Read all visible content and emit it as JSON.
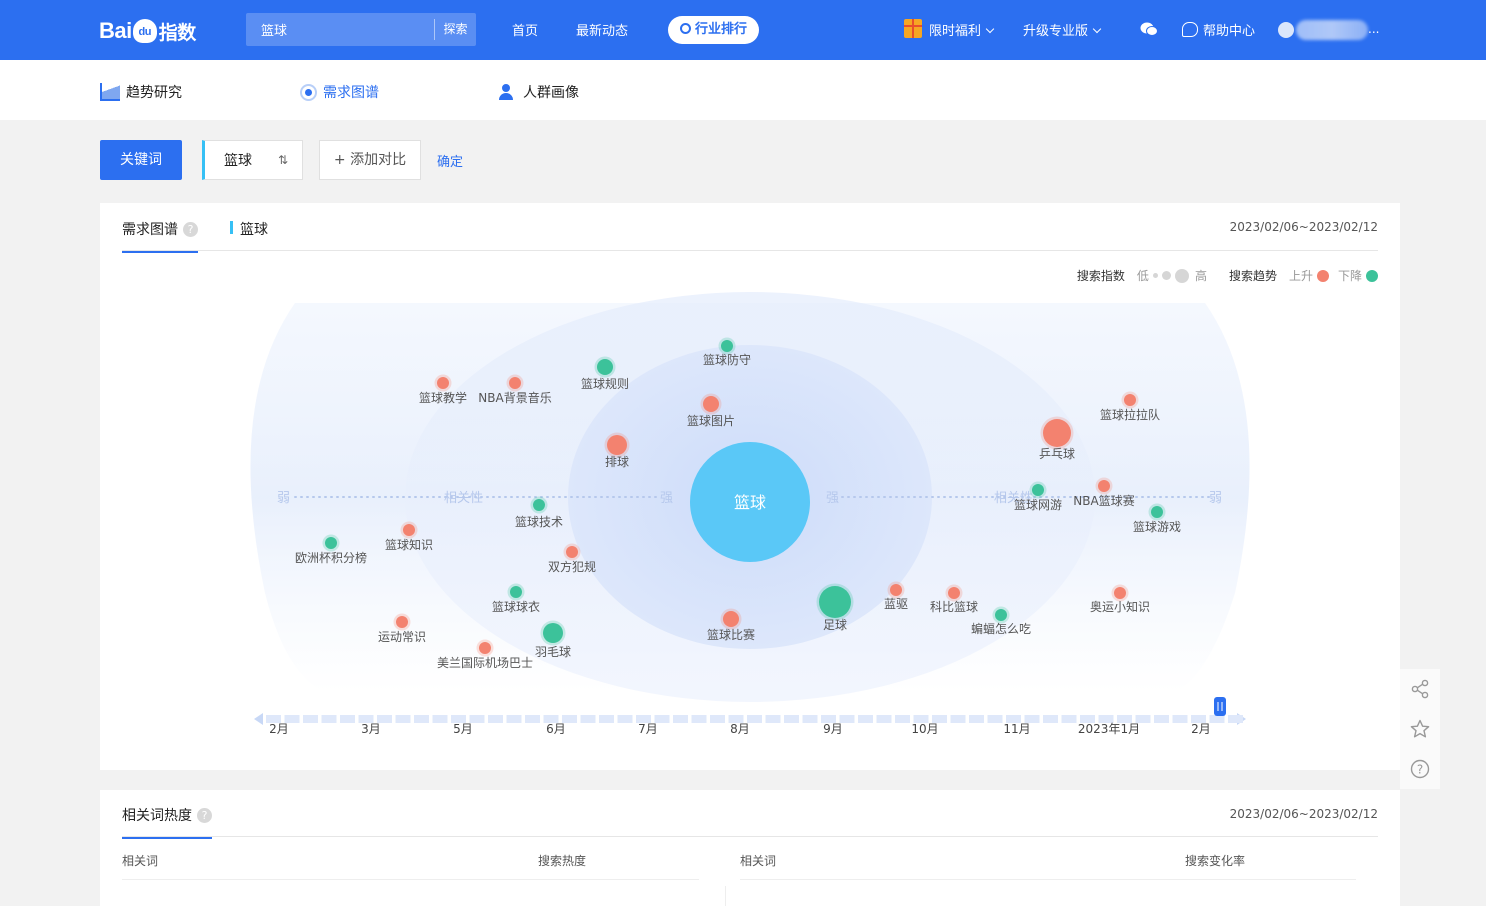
{
  "brand": {
    "logo_text_1": "Bai",
    "logo_paw_text": "du",
    "logo_text_2": "指数"
  },
  "search": {
    "value": "篮球",
    "button": "探索"
  },
  "topnav": {
    "home": "首页",
    "news": "最新动态",
    "industry_rank": "行业排行",
    "benefits": "限时福利",
    "upgrade": "升级专业版",
    "help": "帮助中心",
    "user_suffix": "..."
  },
  "subnav": {
    "trend": "趋势研究",
    "demand": "需求图谱",
    "crowd": "人群画像"
  },
  "query": {
    "keyword_tab": "关键词",
    "keyword": "篮球",
    "add_compare": "+ 添加对比",
    "confirm": "确定"
  },
  "graph_card": {
    "tab": "需求图谱",
    "keyword_legend": "篮球",
    "date_range": "2023/02/06~2023/02/12",
    "legend": {
      "index_label": "搜索指数",
      "low": "低",
      "high": "高",
      "trend_label": "搜索趋势",
      "up": "上升",
      "down": "下降"
    },
    "axis": {
      "weak": "弱",
      "relevance": "相关性",
      "strong": "强"
    },
    "center": "篮球",
    "colors": {
      "up": "#f3826f",
      "down": "#3cc29a",
      "center": "#5ac8f7"
    },
    "nodes": [
      {
        "label": "篮球防守",
        "trend": "down",
        "size": 1
      },
      {
        "label": "篮球规则",
        "trend": "down",
        "size": 2
      },
      {
        "label": "篮球教学",
        "trend": "up",
        "size": 1
      },
      {
        "label": "NBA背景音乐",
        "trend": "up",
        "size": 1
      },
      {
        "label": "篮球图片",
        "trend": "up",
        "size": 2
      },
      {
        "label": "排球",
        "trend": "up",
        "size": 3
      },
      {
        "label": "篮球技术",
        "trend": "down",
        "size": 1
      },
      {
        "label": "篮球知识",
        "trend": "up",
        "size": 1
      },
      {
        "label": "欧洲杯积分榜",
        "trend": "down",
        "size": 1
      },
      {
        "label": "双方犯规",
        "trend": "up",
        "size": 1
      },
      {
        "label": "篮球球衣",
        "trend": "down",
        "size": 1
      },
      {
        "label": "运动常识",
        "trend": "up",
        "size": 1
      },
      {
        "label": "羽毛球",
        "trend": "down",
        "size": 3
      },
      {
        "label": "美兰国际机场巴士",
        "trend": "up",
        "size": 1
      },
      {
        "label": "篮球比赛",
        "trend": "up",
        "size": 2
      },
      {
        "label": "足球",
        "trend": "down",
        "size": 5
      },
      {
        "label": "蓝驱",
        "trend": "up",
        "size": 1
      },
      {
        "label": "科比篮球",
        "trend": "up",
        "size": 1
      },
      {
        "label": "蝙蝠怎么吃",
        "trend": "down",
        "size": 1
      },
      {
        "label": "乒乓球",
        "trend": "up",
        "size": 4
      },
      {
        "label": "篮球网游",
        "trend": "down",
        "size": 1
      },
      {
        "label": "NBA篮球赛",
        "trend": "up",
        "size": 1
      },
      {
        "label": "篮球游戏",
        "trend": "down",
        "size": 1
      },
      {
        "label": "篮球拉拉队",
        "trend": "up",
        "size": 1
      },
      {
        "label": "奥运小知识",
        "trend": "up",
        "size": 1
      }
    ],
    "timeline": {
      "months": [
        "2月",
        "3月",
        "5月",
        "6月",
        "7月",
        "8月",
        "9月",
        "10月",
        "11月",
        "2023年1月",
        "2月"
      ]
    }
  },
  "related_card": {
    "tab": "相关词热度",
    "date_range": "2023/02/06~2023/02/12",
    "left_headers": [
      "相关词",
      "搜索热度"
    ],
    "right_headers": [
      "相关词",
      "搜索变化率"
    ]
  },
  "side_tools": [
    "share-icon",
    "star-icon",
    "help-icon"
  ]
}
